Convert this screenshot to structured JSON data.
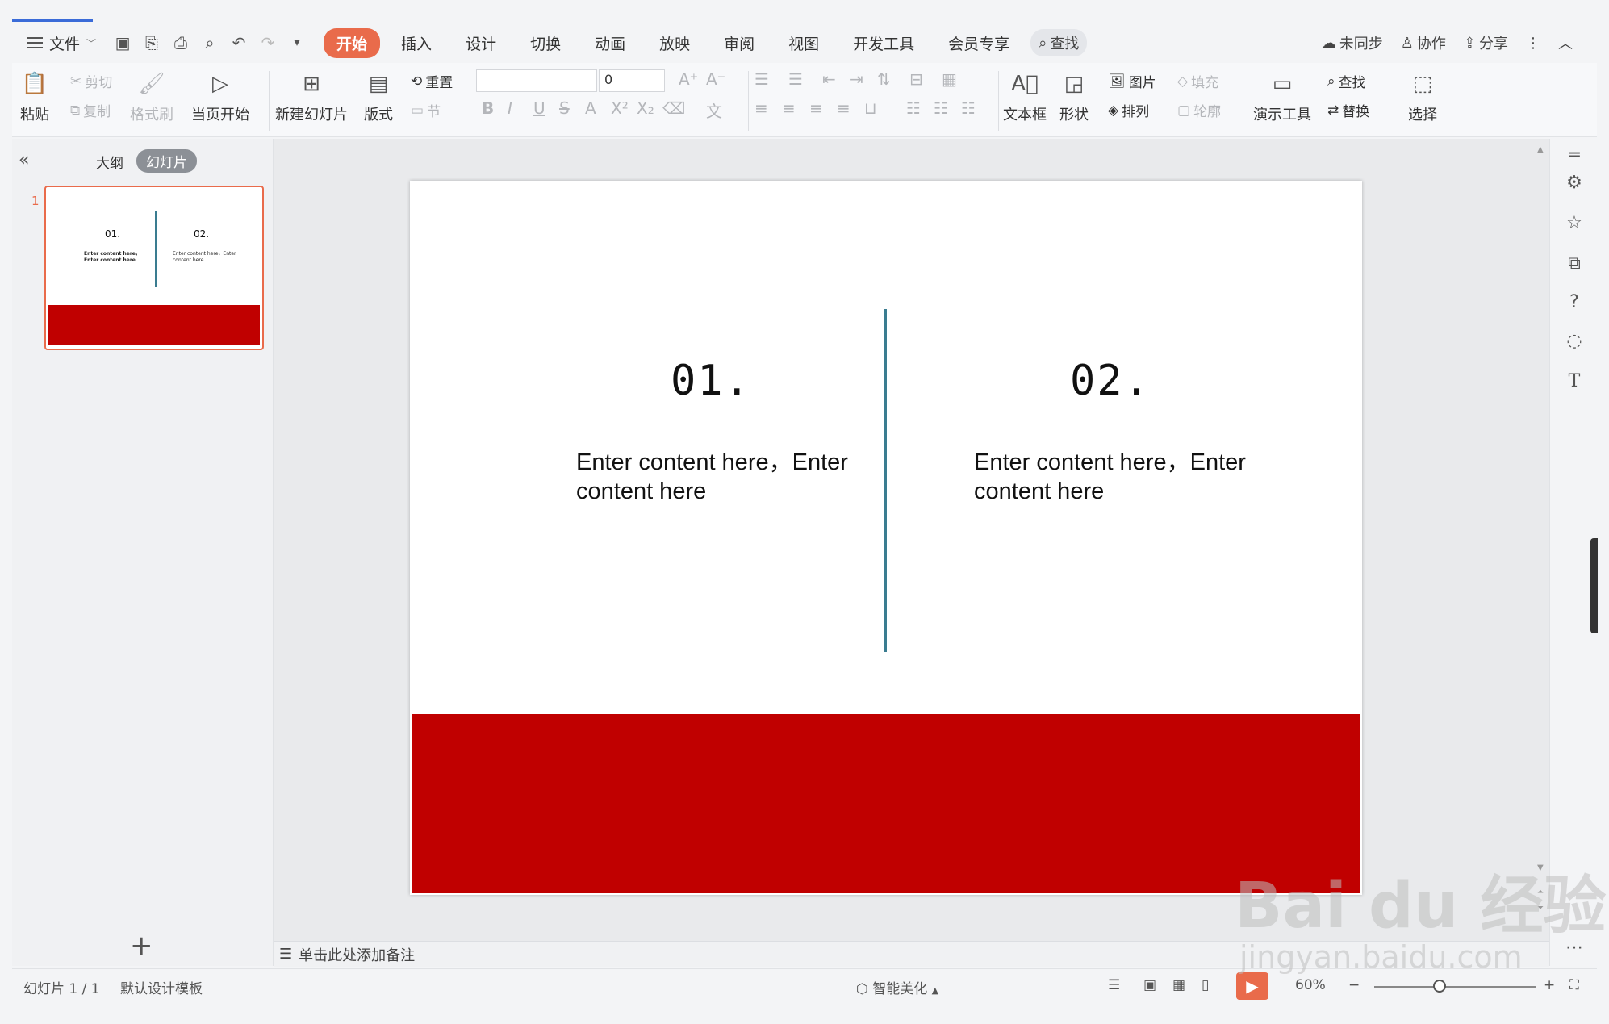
{
  "tabbar": {
    "file_menu": "文件",
    "tabs": [
      {
        "label": "开始",
        "active": true
      },
      {
        "label": "插入",
        "active": false
      },
      {
        "label": "设计",
        "active": false
      },
      {
        "label": "切换",
        "active": false
      },
      {
        "label": "动画",
        "active": false
      },
      {
        "label": "放映",
        "active": false
      },
      {
        "label": "审阅",
        "active": false
      },
      {
        "label": "视图",
        "active": false
      },
      {
        "label": "开发工具",
        "active": false
      },
      {
        "label": "会员专享",
        "active": false
      }
    ],
    "search_label": "查找",
    "right": {
      "sync": "未同步",
      "collab": "协作",
      "share": "分享"
    }
  },
  "ribbon": {
    "paste": "粘贴",
    "cut": "剪切",
    "copy": "复制",
    "format_painter": "格式刷",
    "play_current": "当页开始",
    "new_slide": "新建幻灯片",
    "layout": "版式",
    "reset": "重置",
    "section": "节",
    "font_size": "0",
    "textbox": "文本框",
    "shape": "形状",
    "picture": "图片",
    "arrange": "排列",
    "fill": "填充",
    "outline": "轮廓",
    "present_tools": "演示工具",
    "find": "查找",
    "replace": "替换",
    "select": "选择"
  },
  "left_panel": {
    "tab_outline": "大纲",
    "tab_slides": "幻灯片",
    "slide_number": "1"
  },
  "slide": {
    "col1_number": "01.",
    "col1_text": "Enter content here，Enter content here",
    "col2_number": "02.",
    "col2_text": "Enter content here，Enter content here",
    "thumb_col1_text": "Enter content here，Enter content here",
    "thumb_col2_text": "Enter content here，Enter content here",
    "accent_color": "#c00000",
    "divider_color": "#3a7c90"
  },
  "notes_placeholder": "单击此处添加备注",
  "statusbar": {
    "slide_count": "幻灯片 1 / 1",
    "template": "默认设计模板",
    "smart_beautify": "智能美化",
    "zoom": "60%"
  },
  "watermark": {
    "main": "Bai du 经验",
    "sub": "jingyan.baidu.com"
  }
}
